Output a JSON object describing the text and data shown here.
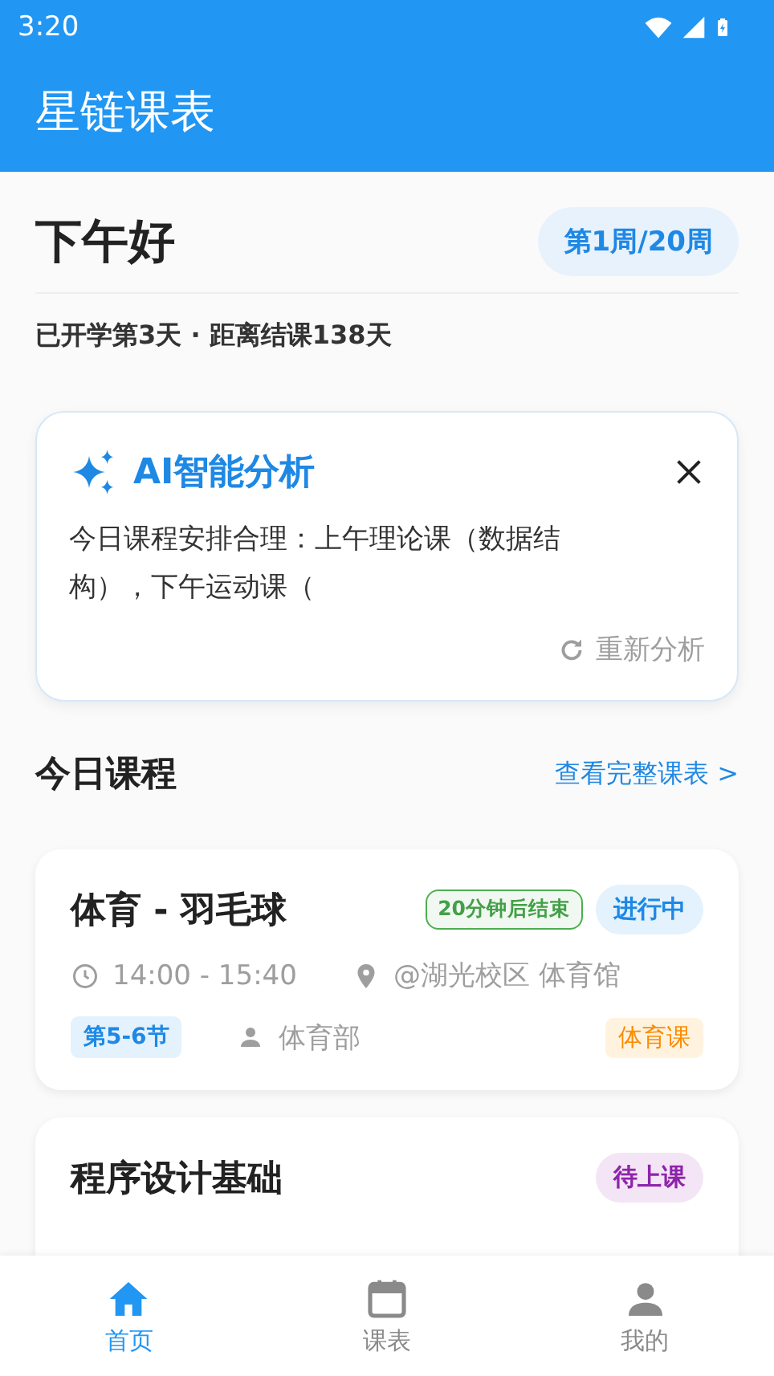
{
  "status_bar": {
    "time": "3:20"
  },
  "app_bar": {
    "title": "星链课表"
  },
  "greeting": {
    "text": "下午好",
    "week": "第1周/20周",
    "days_info": "已开学第3天 · 距离结课138天"
  },
  "ai_card": {
    "title": "AI智能分析",
    "body": "今日课程安排合理：上午理论课（数据结构），下午运动课（",
    "action": "重新分析"
  },
  "today": {
    "title": "今日课程",
    "link": "查看完整课表 >"
  },
  "courses": [
    {
      "name": "体育 - 羽毛球",
      "countdown": "20分钟后结束",
      "status": "进行中",
      "kind": "ongoing",
      "time": "14:00 - 15:40",
      "location": "@湖光校区 体育馆",
      "periods": "第5-6节",
      "teacher": "体育部",
      "category": "体育课"
    },
    {
      "name": "程序设计基础",
      "status": "待上课",
      "kind": "upcoming"
    }
  ],
  "bottom_nav": [
    {
      "label": "首页",
      "kind": "home",
      "selected": true
    },
    {
      "label": "课表",
      "kind": "calendar",
      "selected": false
    },
    {
      "label": "我的",
      "kind": "profile",
      "selected": false
    }
  ]
}
